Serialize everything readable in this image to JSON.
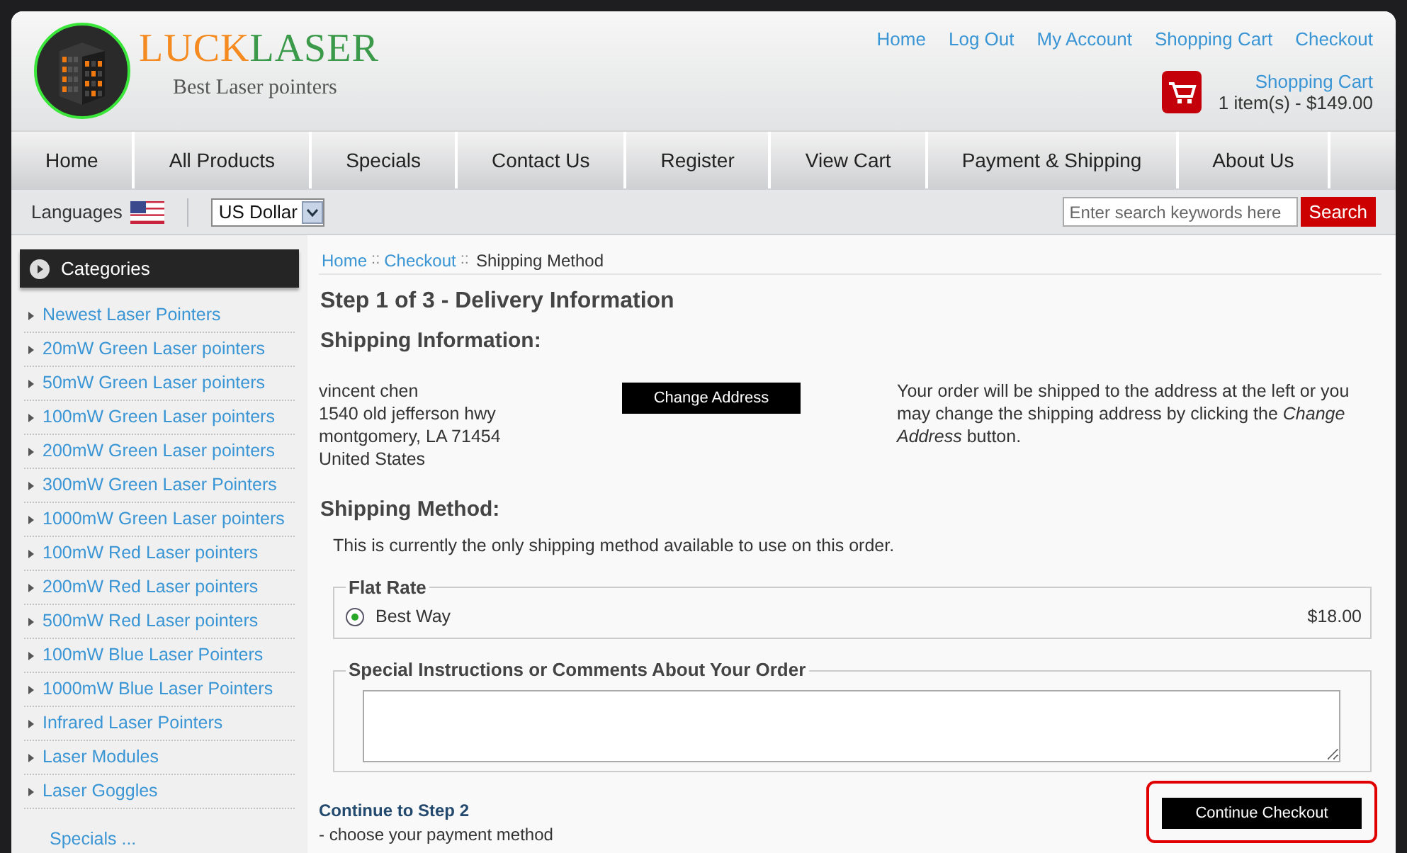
{
  "logo": {
    "name_part_1": "LUCK",
    "name_part_2": "LASER",
    "tagline": "Best Laser pointers"
  },
  "top_links": [
    "Home",
    "Log Out",
    "My Account",
    "Shopping Cart",
    "Checkout"
  ],
  "cart": {
    "title": "Shopping Cart",
    "summary": "1 item(s) - $149.00"
  },
  "nav": [
    "Home",
    "All Products",
    "Specials",
    "Contact Us",
    "Register",
    "View Cart",
    "Payment & Shipping",
    "About Us"
  ],
  "toolbar": {
    "languages_label": "Languages",
    "currency": "US Dollar",
    "search": {
      "placeholder": "Enter search keywords here"
    },
    "search_button": "Search"
  },
  "sidebar": {
    "title": "Categories",
    "items": [
      "Newest Laser Pointers",
      "20mW Green Laser pointers",
      "50mW Green Laser pointers",
      "100mW Green Laser pointers",
      "200mW Green Laser pointers",
      "300mW Green Laser Pointers",
      "1000mW Green Laser pointers",
      "100mW Red Laser pointers",
      "200mW Red Laser pointers",
      "500mW Red Laser pointers",
      "100mW Blue Laser Pointers",
      "1000mW Blue Laser Pointers",
      "Infrared Laser Pointers",
      "Laser Modules",
      "Laser Goggles"
    ],
    "more": "Specials ..."
  },
  "breadcrumb": {
    "separator": "::",
    "links": [
      "Home",
      "Checkout"
    ],
    "current": "Shipping Method"
  },
  "step_title": "Step 1 of 3 - Delivery Information",
  "shipping_info": {
    "heading": "Shipping Information:",
    "address": [
      "vincent chen",
      "1540 old jefferson hwy",
      "montgomery, LA 71454",
      "United States"
    ],
    "change_button": "Change Address",
    "note": "Your order will be shipped to the address at the left or you may change the shipping address by clicking the *Change Address* button."
  },
  "shipping_method": {
    "heading": "Shipping Method:",
    "note": "This is currently the only shipping method available to use on this order.",
    "group": "Flat Rate",
    "options": [
      {
        "label": "Best Way",
        "price": "$18.00",
        "selected": true
      }
    ]
  },
  "comments": {
    "legend": "Special Instructions or Comments About Your Order"
  },
  "continue": {
    "title": "Continue to Step 2",
    "subtitle": "- choose your payment method",
    "button": "Continue Checkout",
    "highlighted": true
  }
}
